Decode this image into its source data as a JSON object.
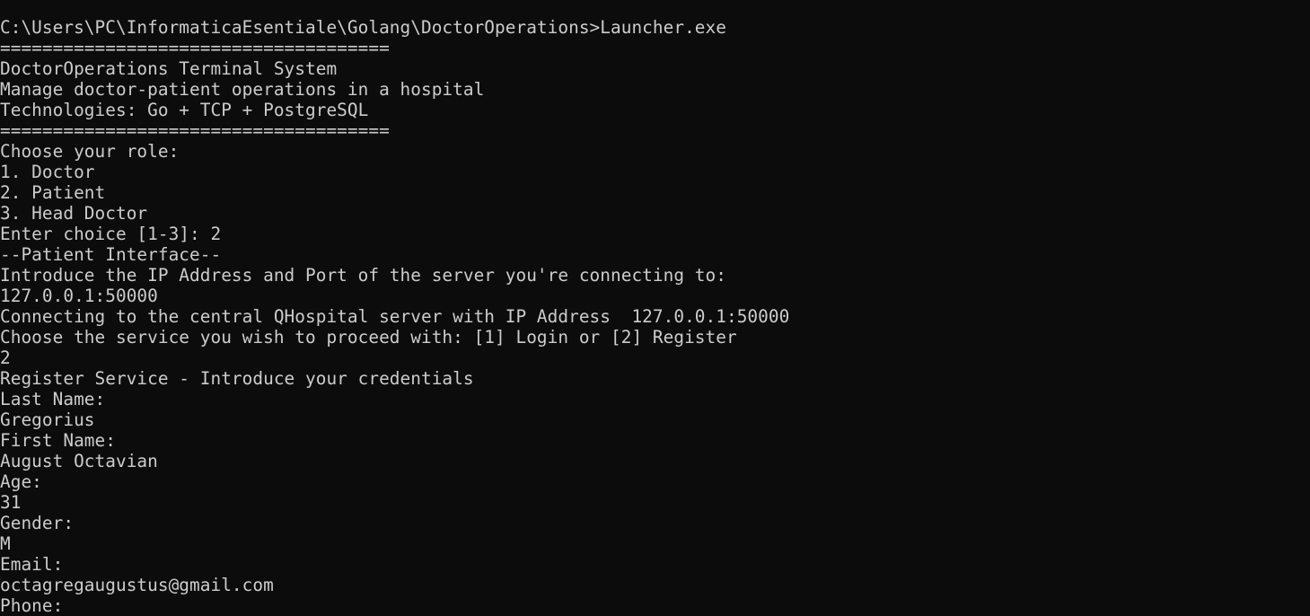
{
  "terminal": {
    "background": "#0c0c0c",
    "foreground": "#cccccc",
    "lines": [
      "C:\\Users\\PC\\InformaticaEsentiale\\Golang\\DoctorOperations>Launcher.exe",
      "=====================================",
      "DoctorOperations Terminal System",
      "Manage doctor-patient operations in a hospital",
      "Technologies: Go + TCP + PostgreSQL",
      "=====================================",
      "Choose your role:",
      "1. Doctor",
      "2. Patient",
      "3. Head Doctor",
      "Enter choice [1-3]: 2",
      "--Patient Interface--",
      "Introduce the IP Address and Port of the server you're connecting to:",
      "127.0.0.1:50000",
      "Connecting to the central QHospital server with IP Address  127.0.0.1:50000",
      "Choose the service you wish to proceed with: [1] Login or [2] Register",
      "2",
      "Register Service - Introduce your credentials",
      "Last Name:",
      "Gregorius",
      "First Name:",
      "August Octavian",
      "Age:",
      "31",
      "Gender:",
      "M",
      "Email:",
      "octagregaugustus@gmail.com",
      "Phone:"
    ]
  }
}
